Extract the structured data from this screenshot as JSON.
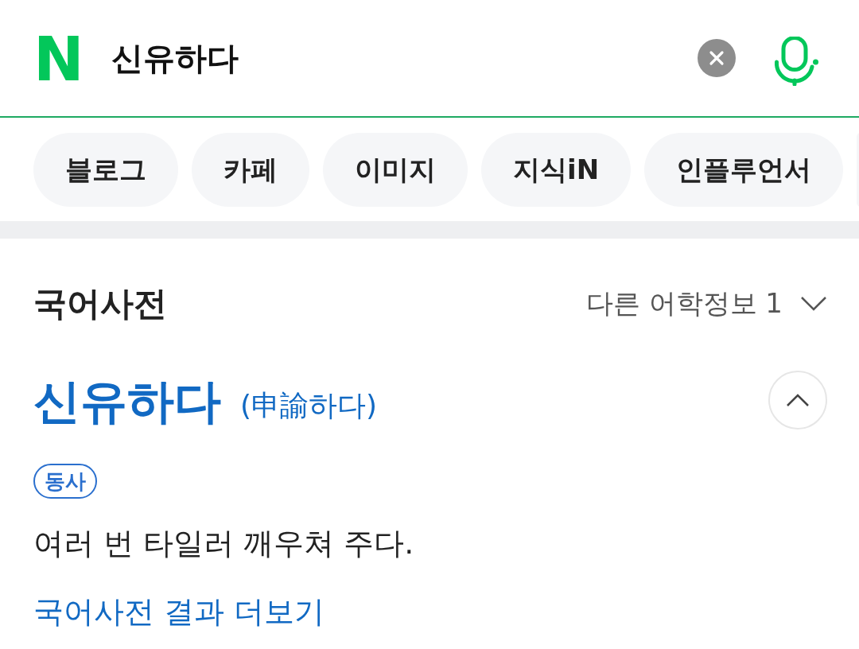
{
  "search_bar": {
    "logo": "N",
    "query": "신유하다"
  },
  "tabs": [
    {
      "label": "블로그",
      "selected": false
    },
    {
      "label": "카페",
      "selected": false
    },
    {
      "label": "이미지",
      "selected": false
    },
    {
      "label": "지식iN",
      "selected": false
    },
    {
      "label": "인플루언서",
      "selected": false
    }
  ],
  "dictionary": {
    "title": "국어사전",
    "other_info": {
      "label": "다른 어학정보 1",
      "expanded": false
    },
    "entry": {
      "headword": "신유하다",
      "hanja": "(申諭하다)",
      "expanded": true,
      "part_of_speech": "동사",
      "definition": "여러 번 타일러 깨우쳐 주다."
    },
    "more_link": "국어사전 결과 더보기"
  }
}
